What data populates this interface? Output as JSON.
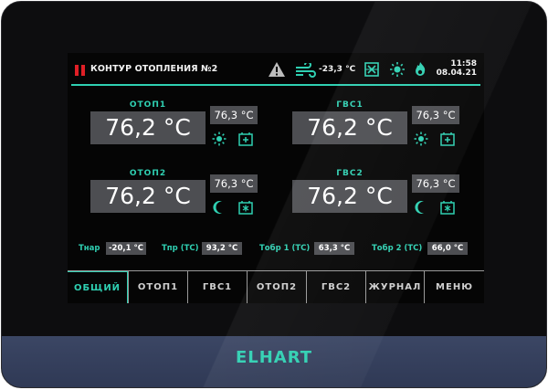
{
  "brand": "ELHART",
  "colors": {
    "accent": "#2fd0b2",
    "alarm": "#e01f26",
    "panel": "#4d4e52",
    "bezel": "#3b4664"
  },
  "status_bar": {
    "title": "КОНТУР ОТОПЛЕНИЯ №2",
    "outdoor_temp": "-23,3 °C",
    "time": "11:58",
    "date": "08.04.21",
    "icons": [
      "alarm-icon",
      "warning-icon",
      "wind-icon",
      "heater-fault-icon",
      "sun-icon",
      "flame-icon"
    ]
  },
  "circuits": [
    {
      "name": "ОТОП1",
      "temp": "76,2 °C",
      "setpoint": "76,3 °C",
      "mode_icon": "sun-icon",
      "status_icon": "heater-icon"
    },
    {
      "name": "ГВС1",
      "temp": "76,2 °C",
      "setpoint": "76,3 °C",
      "mode_icon": "sun-icon",
      "status_icon": "heater-icon"
    },
    {
      "name": "ОТОП2",
      "temp": "76,2 °C",
      "setpoint": "76,3 °C",
      "mode_icon": "moon-icon",
      "status_icon": "cooling-icon"
    },
    {
      "name": "ГВС2",
      "temp": "76,2 °C",
      "setpoint": "76,3 °C",
      "mode_icon": "moon-icon",
      "status_icon": "cooling-icon"
    }
  ],
  "sensors": [
    {
      "label": "Тнар",
      "value": "-20,1 °C"
    },
    {
      "label": "Тпр (ТС)",
      "value": "93,2 °C"
    },
    {
      "label": "Тобр 1 (ТС)",
      "value": "63,3 °C"
    },
    {
      "label": "Тобр 2 (ТС)",
      "value": "66,0 °C"
    }
  ],
  "nav": {
    "active": "ОБЩИЙ",
    "tabs": [
      "ОБЩИЙ",
      "ОТОП1",
      "ГВС1",
      "ОТОП2",
      "ГВС2",
      "ЖУРНАЛ",
      "МЕНЮ"
    ]
  }
}
